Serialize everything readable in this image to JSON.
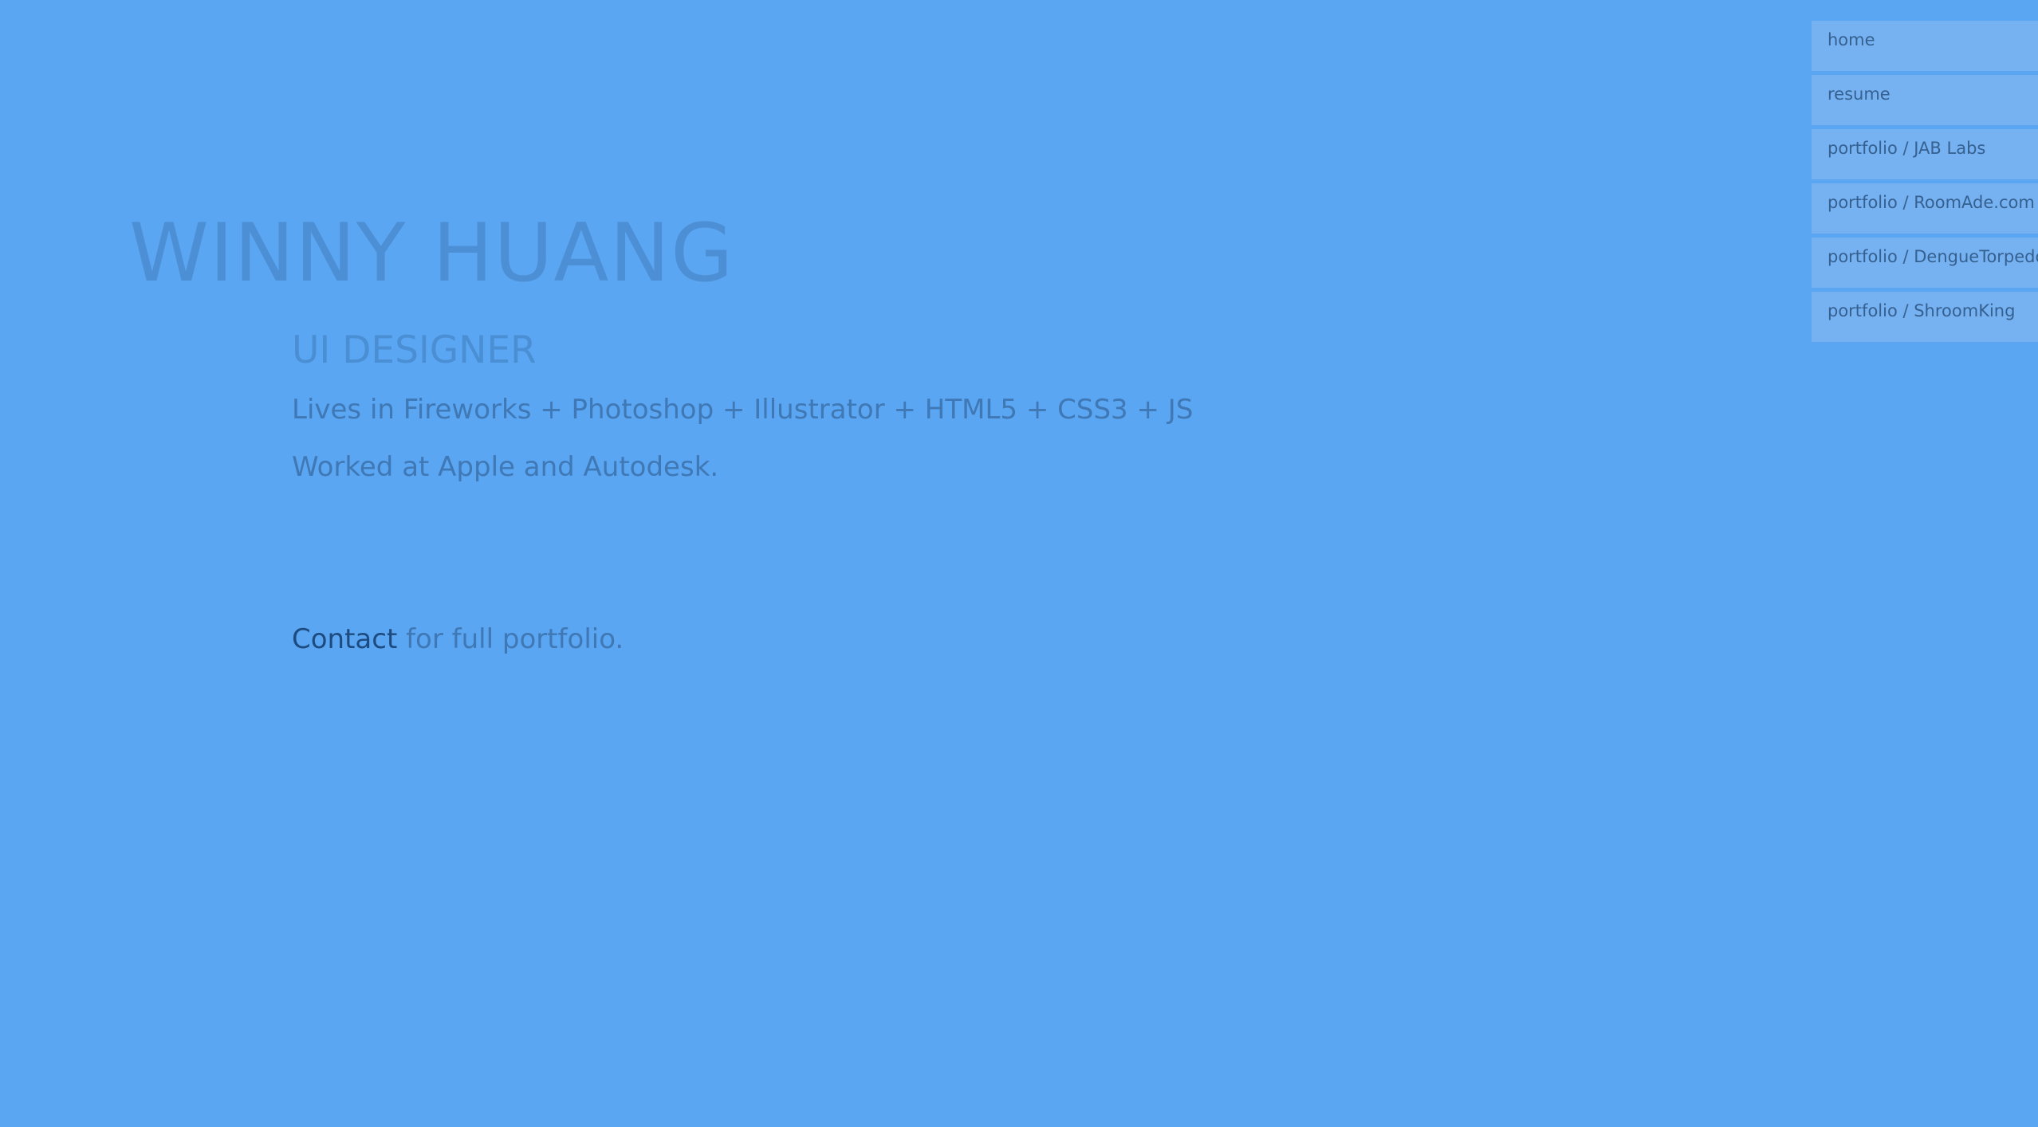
{
  "header": {
    "name": "WINNY HUANG",
    "role": "UI DESIGNER"
  },
  "bio": {
    "tools": "Lives in Fireworks + Photoshop + Illustrator + HTML5 + CSS3 + JS",
    "worked": "Worked at Apple and Autodesk."
  },
  "contact": {
    "link_label": "Contact",
    "suffix": " for full portfolio."
  },
  "nav": {
    "items": [
      {
        "label": "home"
      },
      {
        "label": "resume"
      },
      {
        "label": "portfolio / JAB Labs"
      },
      {
        "label": "portfolio / RoomAde.com"
      },
      {
        "label": "portfolio / DengueTorpedo"
      },
      {
        "label": "portfolio / ShroomKing"
      }
    ]
  },
  "colors": {
    "background": "#5aa6f2",
    "nav_item": "#76b2f2",
    "link": "#1d4b80"
  }
}
